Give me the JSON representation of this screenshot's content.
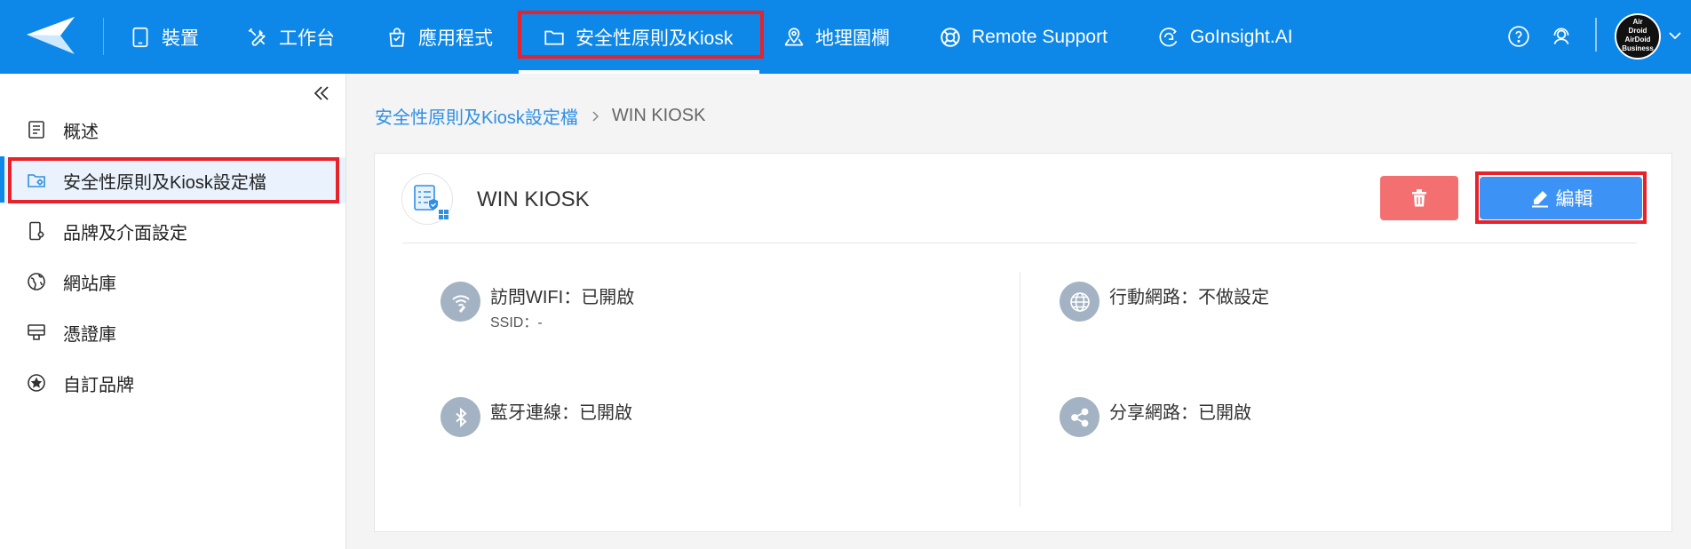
{
  "nav": {
    "items": [
      {
        "label": "裝置",
        "icon": "tablet-icon"
      },
      {
        "label": "工作台",
        "icon": "tools-icon"
      },
      {
        "label": "應用程式",
        "icon": "shopping-bag-icon"
      },
      {
        "label": "安全性原則及Kiosk",
        "icon": "folder-icon"
      },
      {
        "label": "地理圍欄",
        "icon": "map-pin-icon"
      },
      {
        "label": "Remote Support",
        "icon": "lifebuoy-icon"
      },
      {
        "label": "GoInsight.AI",
        "icon": "goinsight-icon"
      }
    ],
    "active": "安全性原則及Kiosk",
    "avatar_text": [
      "Air",
      "Droid",
      "AirDoid",
      "Business"
    ]
  },
  "sidebar": {
    "items": [
      {
        "label": "概述",
        "icon": "overview-icon"
      },
      {
        "label": "安全性原則及Kiosk設定檔",
        "icon": "folder-settings-icon"
      },
      {
        "label": "品牌及介面設定",
        "icon": "phone-settings-icon"
      },
      {
        "label": "網站庫",
        "icon": "globe-icon"
      },
      {
        "label": "憑證庫",
        "icon": "certificate-icon"
      },
      {
        "label": "自訂品牌",
        "icon": "star-badge-icon"
      }
    ],
    "active": "安全性原則及Kiosk設定檔"
  },
  "breadcrumb": {
    "parent": "安全性原則及Kiosk設定檔",
    "current": "WIN KIOSK"
  },
  "policy": {
    "title": "WIN KIOSK",
    "edit_label": "編輯",
    "features": [
      {
        "label": "訪問WIFI：已開啟",
        "sub": "SSID：-",
        "icon": "wifi-icon"
      },
      {
        "label": "行動網路：不做設定",
        "icon": "network-globe-icon"
      },
      {
        "label": "藍牙連線：已開啟",
        "icon": "bluetooth-icon"
      },
      {
        "label": "分享網路：已開啟",
        "icon": "share-icon"
      }
    ]
  },
  "colors": {
    "brand": "#0d87e8",
    "danger": "#f47070",
    "primary_button": "#3d93f5",
    "highlight": "#e8212a"
  }
}
